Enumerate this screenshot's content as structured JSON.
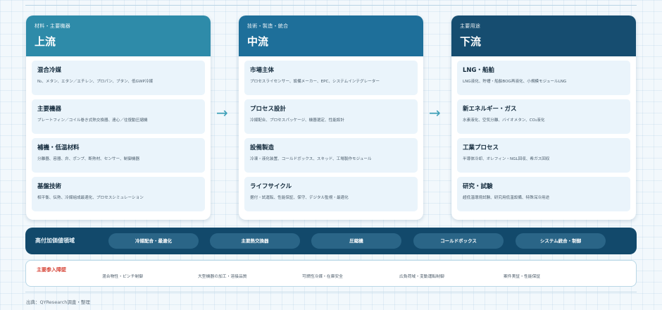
{
  "upstream": {
    "subtitle": "材料・主要機器",
    "title": "上流",
    "items": [
      {
        "title": "混合冷媒",
        "desc": "N₂、メタン、エタン／エチレン、プロパン、ブタン、低GWP冷媒"
      },
      {
        "title": "主要機器",
        "desc": "プレートフィン／コイル巻き式熱交換器、遠心／往復動圧縮機"
      },
      {
        "title": "補機・低温材料",
        "desc": "分離器、容器、弁、ポンプ、断熱材、センサー、制御機器"
      },
      {
        "title": "基盤技術",
        "desc": "相平衡、伝熱、冷媒組成最適化、プロセスシミュレーション"
      }
    ]
  },
  "midstream": {
    "subtitle": "技術・製造・統合",
    "title": "中流",
    "items": [
      {
        "title": "市場主体",
        "desc": "プロセスライセンサー、設備メーカー、EPC、システムインテグレーター"
      },
      {
        "title": "プロセス設計",
        "desc": "冷媒配合、プロセスパッケージ、機器選定、性能設計"
      },
      {
        "title": "設備製造",
        "desc": "冷凍・液化装置、コールドボックス、スキッド、工場製作モジュール"
      },
      {
        "title": "ライフサイクル",
        "desc": "据付・試運転、性能保証、保守、デジタル監視・最適化"
      }
    ]
  },
  "downstream": {
    "subtitle": "主要用途",
    "title": "下流",
    "items": [
      {
        "title": "LNG・船舶",
        "desc": "LNG液化、貯槽・船舶BOG再液化、小規模モジュールLNG"
      },
      {
        "title": "新エネルギー・ガス",
        "desc": "水素液化、空気分離、バイオメタン、CO₂液化"
      },
      {
        "title": "工業プロセス",
        "desc": "半導体冷却、オレフィン・NGL回収、希ガス回収"
      },
      {
        "title": "研究・試験",
        "desc": "超低温環境試験、研究用低温設備、特殊深冷用途"
      }
    ]
  },
  "arrows": {
    "symbol": "→"
  },
  "high_value": {
    "label": "高付加価値領域",
    "pills": [
      "冷媒配合・最適化",
      "主要熱交換器",
      "圧縮機",
      "コールドボックス",
      "システム統合・制御"
    ]
  },
  "barriers": {
    "title": "主要参入障壁",
    "items": [
      "混合物性・ピンチ制御",
      "大型機器の加工・溶接品質",
      "可燃性冷媒・在庫安全",
      "広負荷域・変動運転制御",
      "案件実証・性能保証"
    ]
  },
  "source": "出典：QYResearch調査・整理",
  "colors": {
    "upstream_header": "#2e8ba9",
    "midstream_header": "#1e6f9a",
    "downstream_header": "#164d70",
    "high_value_bar": "#12496b",
    "barrier_title": "#d7473a",
    "arrow": "#3fa0b8"
  }
}
